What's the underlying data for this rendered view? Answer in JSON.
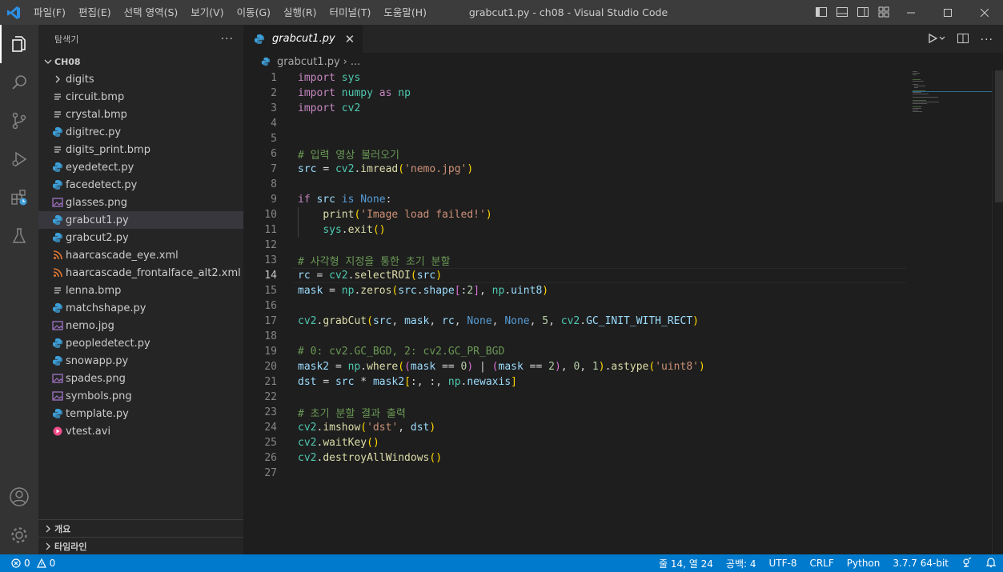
{
  "titlebar": {
    "menus": [
      "파일(F)",
      "편집(E)",
      "선택 영역(S)",
      "보기(V)",
      "이동(G)",
      "실행(R)",
      "터미널(T)",
      "도움말(H)"
    ],
    "window_title": "grabcut1.py - ch08 - Visual Studio Code"
  },
  "sidebar": {
    "title": "탐색기",
    "more": "···",
    "folder": "CH08",
    "items": [
      {
        "label": "digits",
        "icon": "chevron-right-icon"
      },
      {
        "label": "circuit.bmp",
        "icon": "lines-file-icon"
      },
      {
        "label": "crystal.bmp",
        "icon": "lines-file-icon"
      },
      {
        "label": "digitrec.py",
        "icon": "python-icon"
      },
      {
        "label": "digits_print.bmp",
        "icon": "lines-file-icon"
      },
      {
        "label": "eyedetect.py",
        "icon": "python-icon"
      },
      {
        "label": "facedetect.py",
        "icon": "python-icon"
      },
      {
        "label": "glasses.png",
        "icon": "image-icon"
      },
      {
        "label": "grabcut1.py",
        "icon": "python-icon",
        "selected": true
      },
      {
        "label": "grabcut2.py",
        "icon": "python-icon"
      },
      {
        "label": "haarcascade_eye.xml",
        "icon": "rss-icon"
      },
      {
        "label": "haarcascade_frontalface_alt2.xml",
        "icon": "rss-icon"
      },
      {
        "label": "lenna.bmp",
        "icon": "lines-file-icon"
      },
      {
        "label": "matchshape.py",
        "icon": "python-icon"
      },
      {
        "label": "nemo.jpg",
        "icon": "image-icon"
      },
      {
        "label": "peopledetect.py",
        "icon": "python-icon"
      },
      {
        "label": "snowapp.py",
        "icon": "python-icon"
      },
      {
        "label": "spades.png",
        "icon": "image-icon"
      },
      {
        "label": "symbols.png",
        "icon": "image-icon"
      },
      {
        "label": "template.py",
        "icon": "python-icon"
      },
      {
        "label": "vtest.avi",
        "icon": "video-icon"
      }
    ],
    "sections": [
      "개요",
      "타임라인"
    ]
  },
  "editor": {
    "tab_label": "grabcut1.py",
    "breadcrumb": {
      "file": "grabcut1.py",
      "more": "..."
    },
    "current_line": 14,
    "lines": [
      "import sys",
      "import numpy as np",
      "import cv2",
      "",
      "",
      "# 입력 영상 불러오기",
      "src = cv2.imread('nemo.jpg')",
      "",
      "if src is None:",
      "    print('Image load failed!')",
      "    sys.exit()",
      "",
      "# 사각형 지정을 통한 초기 분할",
      "rc = cv2.selectROI(src)",
      "mask = np.zeros(src.shape[:2], np.uint8)",
      "",
      "cv2.grabCut(src, mask, rc, None, None, 5, cv2.GC_INIT_WITH_RECT)",
      "",
      "# 0: cv2.GC_BGD, 2: cv2.GC_PR_BGD",
      "mask2 = np.where((mask == 0) | (mask == 2), 0, 1).astype('uint8')",
      "dst = src * mask2[:, :, np.newaxis]",
      "",
      "# 초기 분할 결과 출력",
      "cv2.imshow('dst', dst)",
      "cv2.waitKey()",
      "cv2.destroyAllWindows()",
      ""
    ]
  },
  "statusbar": {
    "errors": "0",
    "warnings": "0",
    "position": "줄 14, 열 24",
    "spaces": "공백: 4",
    "encoding": "UTF-8",
    "eol": "CRLF",
    "language": "Python",
    "interpreter": "3.7.7 64-bit"
  },
  "colors": {
    "statusbar": "#007acc",
    "accent": "#007acc",
    "python_icon": "#3e9fd8",
    "rss_icon": "#e37933",
    "image_icon": "#a074c4",
    "video_icon": "#f14c8a"
  }
}
